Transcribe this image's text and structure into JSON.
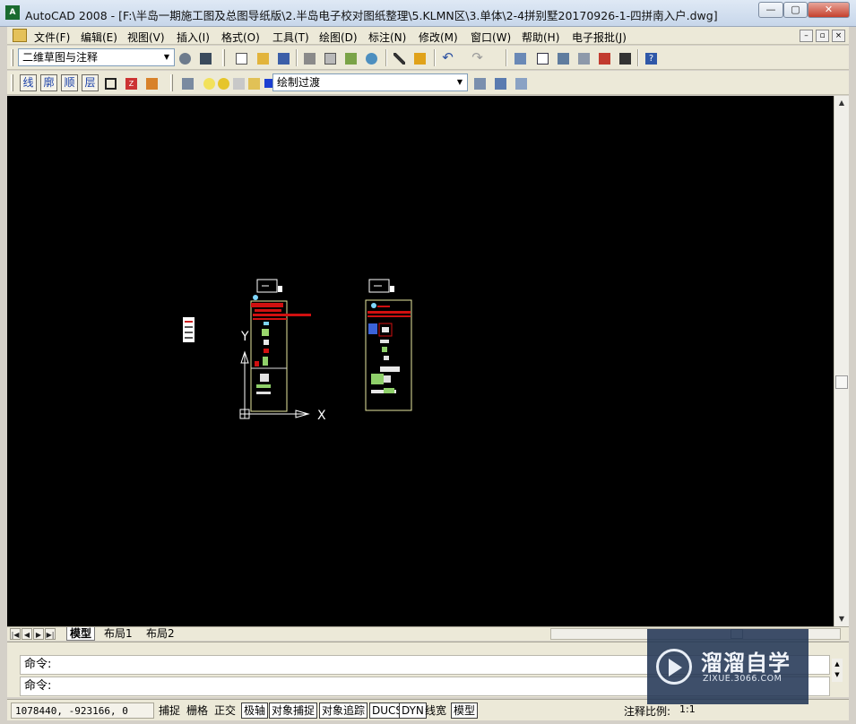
{
  "window": {
    "title": "AutoCAD 2008 - [F:\\半岛一期施工图及总图导纸版\\2.半岛电子校对图纸整理\\5.KLMN区\\3.单体\\2-4拼别墅20170926-1-四拼南入户.dwg]",
    "minimize_glyph": "—",
    "maximize_glyph": "▢",
    "close_glyph": "✕"
  },
  "menu": {
    "items": [
      "文件(F)",
      "编辑(E)",
      "视图(V)",
      "插入(I)",
      "格式(O)",
      "工具(T)",
      "绘图(D)",
      "标注(N)",
      "修改(M)",
      "窗口(W)",
      "帮助(H)",
      "电子报批(J)"
    ],
    "doc_min": "–",
    "doc_restore": "▫",
    "doc_close": "×"
  },
  "toolbar1": {
    "workspace_value": "二维草图与注释",
    "icons": [
      "workspace-settings-icon",
      "workspace-icon",
      "new-file-icon",
      "open-file-icon",
      "save-icon",
      "print-icon",
      "print-preview-icon",
      "publish-icon",
      "plot-3d-icon",
      "cut-icon",
      "match-properties-icon",
      "undo-icon",
      "redo-icon",
      "pan-icon",
      "properties-icon",
      "design-center-icon",
      "tool-palettes-icon",
      "markup-icon",
      "calculator-icon",
      "help-icon"
    ]
  },
  "toolbar2": {
    "cn_buttons": [
      "线",
      "廓",
      "顺",
      "层"
    ],
    "layer_value": "绘制过渡",
    "icons": [
      "layer-manager-icon",
      "lightbulb-icon",
      "sun-icon",
      "lock-icon",
      "layer-color-icon",
      "layer-previous-icon",
      "layer-states-icon",
      "make-current-icon"
    ]
  },
  "drawing": {
    "ucs_x_label": "X",
    "ucs_y_label": "Y"
  },
  "layout_tabs": {
    "nav": [
      "|◀",
      "◀",
      "▶",
      "▶|"
    ],
    "tabs": [
      "模型",
      "布局1",
      "布局2"
    ]
  },
  "command": {
    "line1": "命令:",
    "line2": "命令:"
  },
  "status": {
    "coordinates": "1078440, -923166, 0",
    "toggles": [
      {
        "label": "捕捉",
        "on": false
      },
      {
        "label": "栅格",
        "on": false
      },
      {
        "label": "正交",
        "on": false
      },
      {
        "label": "极轴",
        "on": true
      },
      {
        "label": "对象捕捉",
        "on": true
      },
      {
        "label": "对象追踪",
        "on": true
      },
      {
        "label": "DUCS",
        "on": true
      },
      {
        "label": "DYN",
        "on": true
      },
      {
        "label": "线宽",
        "on": false
      },
      {
        "label": "模型",
        "on": true
      }
    ],
    "annotation_scale_label": "注释比例:",
    "annotation_scale_value": "1:1"
  },
  "watermark": {
    "title": "溜溜自学",
    "subtitle": "ZIXUE.3066.COM"
  },
  "colors": {
    "canvas": "#000000",
    "highlight_red": "#d01010",
    "frame_yellow": "#e8e8a0"
  }
}
